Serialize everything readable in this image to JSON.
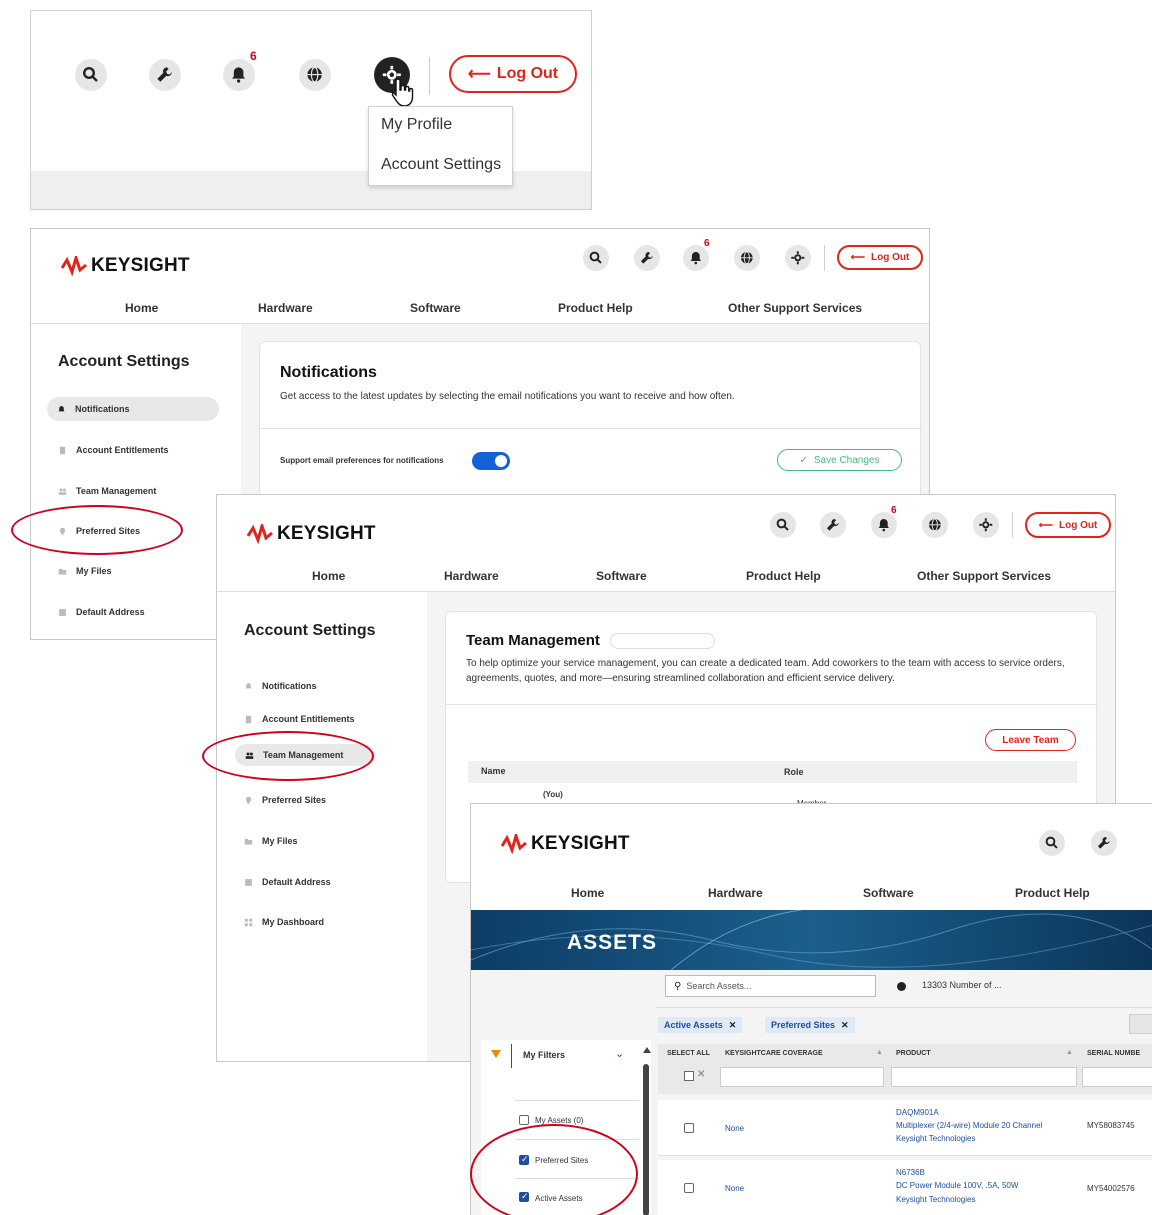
{
  "dropdown_panel": {
    "badge_count": "6",
    "logout_label": "Log Out",
    "menu_items": [
      "My Profile",
      "Account Settings"
    ]
  },
  "brand": {
    "name": "KEYSIGHT"
  },
  "header": {
    "badge_count": "6",
    "logout_label": "Log Out"
  },
  "nav": [
    "Home",
    "Hardware",
    "Software",
    "Product Help",
    "Other Support Services"
  ],
  "panel_notifications": {
    "side_title": "Account Settings",
    "side_items": [
      "Notifications",
      "Account Entitlements",
      "Team Management",
      "Preferred Sites",
      "My Files",
      "Default Address"
    ],
    "title": "Notifications",
    "description": "Get access to the latest updates by selecting the email notifications you want to receive and how often.",
    "toggle_label": "Support email preferences for notifications",
    "save_label": "Save Changes"
  },
  "panel_team": {
    "side_title": "Account Settings",
    "side_items": [
      "Notifications",
      "Account Entitlements",
      "Team Management",
      "Preferred Sites",
      "My Files",
      "Default Address",
      "My Dashboard"
    ],
    "title": "Team Management",
    "description": "To help optimize your service management, you can create a dedicated team. Add coworkers to the team with access to service orders, agreements, quotes, and more—ensuring streamlined collaboration and efficient service delivery.",
    "leave_label": "Leave Team",
    "col_name": "Name",
    "col_role": "Role",
    "row_name": "(You)",
    "row_role": "Member"
  },
  "panel_assets": {
    "nav": [
      "Home",
      "Hardware",
      "Software",
      "Product Help"
    ],
    "banner": "ASSETS",
    "search_placeholder": "Search Assets...",
    "count_text": "13303 Number of ...",
    "chips": [
      "Active Assets",
      "Preferred Sites"
    ],
    "filters_title": "My Filters",
    "filters": [
      {
        "label": "My Assets (0)",
        "checked": false
      },
      {
        "label": "Preferred Sites",
        "checked": true
      },
      {
        "label": "Active Assets",
        "checked": true
      }
    ],
    "columns": [
      "SELECT ALL",
      "KEYSIGHTCARE COVERAGE",
      "PRODUCT",
      "SERIAL NUMBE"
    ],
    "rows": [
      {
        "coverage": "None",
        "product_id": "DAQM901A",
        "product_desc": "Multiplexer (2/4-wire) Module 20 Channel",
        "vendor": "Keysight Technologies",
        "serial": "MY58083745"
      },
      {
        "coverage": "None",
        "product_id": "N6736B",
        "product_desc": "DC Power Module 100V, .5A, 50W",
        "vendor": "Keysight Technologies",
        "serial": "MY54002576"
      }
    ]
  },
  "colors": {
    "accent_red": "#e2231a",
    "link_blue": "#1e4fa0",
    "toggle_blue": "#1463d6",
    "save_green": "#47b87b"
  }
}
